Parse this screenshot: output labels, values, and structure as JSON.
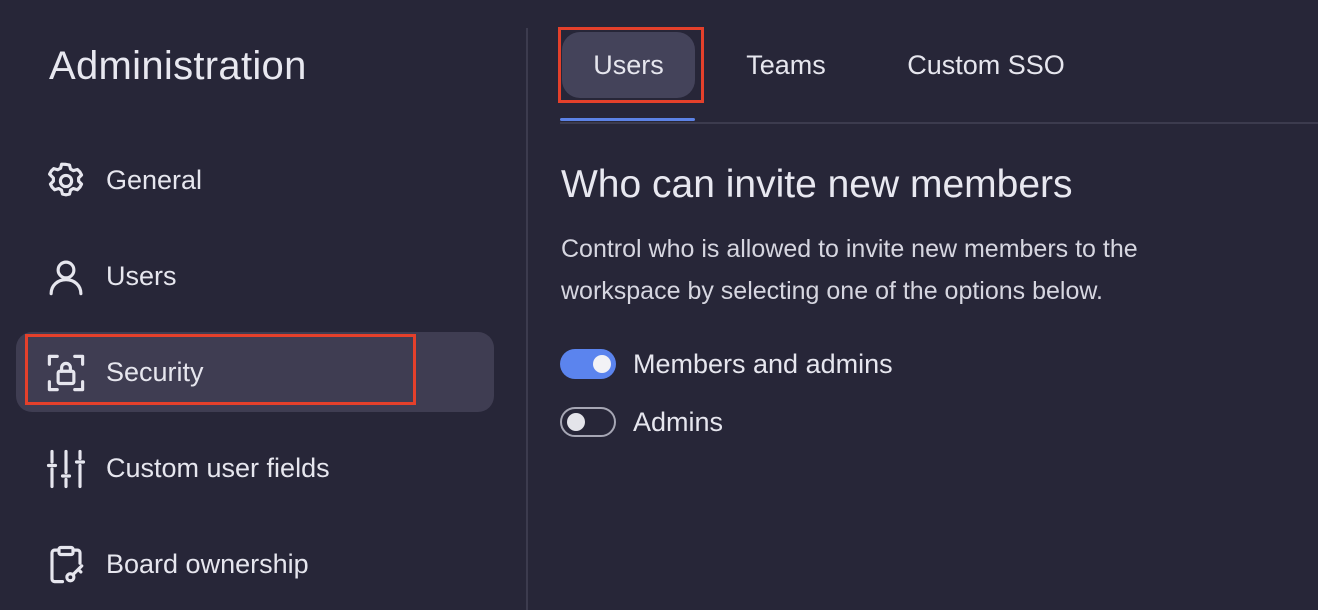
{
  "sidebar": {
    "title": "Administration",
    "items": [
      {
        "label": "General",
        "icon": "gear-icon"
      },
      {
        "label": "Users",
        "icon": "user-icon"
      },
      {
        "label": "Security",
        "icon": "lock-icon",
        "active": true
      },
      {
        "label": "Custom user fields",
        "icon": "sliders-icon"
      },
      {
        "label": "Board ownership",
        "icon": "clipboard-key-icon"
      }
    ]
  },
  "tabs": [
    {
      "label": "Users",
      "active": true
    },
    {
      "label": "Teams"
    },
    {
      "label": "Custom SSO"
    }
  ],
  "section": {
    "title": "Who can invite new members",
    "description": "Control who is allowed to invite new members to the workspace by selecting one of the options below."
  },
  "options": [
    {
      "label": "Members and admins",
      "enabled": true
    },
    {
      "label": "Admins",
      "enabled": false
    }
  ],
  "colors": {
    "background": "#272638",
    "active_item": "#3f3d52",
    "accent": "#5b84ee",
    "highlight": "#e4402b"
  }
}
